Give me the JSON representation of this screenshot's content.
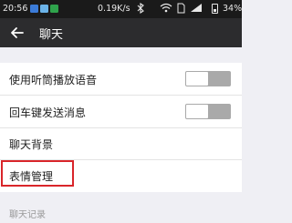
{
  "status_bar": {
    "time": "20:56",
    "network_speed": "0.19K/s",
    "battery": "34%",
    "icons": [
      "notification-app-icon",
      "notification-app-icon-2",
      "download-icon",
      "bluetooth-icon",
      "wifi-icon",
      "sim-card-icon",
      "signal-icon",
      "battery-icon"
    ]
  },
  "nav": {
    "title": "聊天",
    "back_icon": "arrow-left-icon"
  },
  "settings": [
    {
      "label": "使用听筒播放语音",
      "toggle": "off"
    },
    {
      "label": "回车键发送消息",
      "toggle": "off"
    },
    {
      "label": "聊天背景"
    },
    {
      "label": "表情管理",
      "highlighted": true
    }
  ],
  "section": {
    "label": "聊天记录"
  },
  "colors": {
    "status_bar": "#1a1a1a",
    "nav_bar": "#2c2c2e",
    "background": "#efeff4",
    "highlight_border": "#d9252a",
    "toggle_off": "#a9a9a9"
  }
}
